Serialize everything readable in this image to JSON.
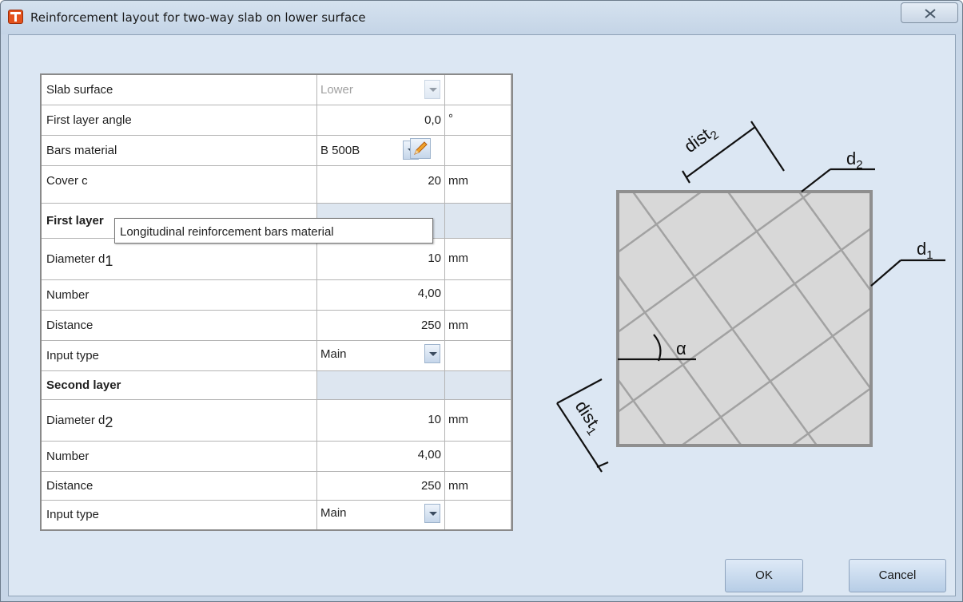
{
  "window": {
    "title": "Reinforcement layout for two-way slab on lower surface",
    "close_icon": "close-x-icon",
    "app_icon": "t-app-icon"
  },
  "grid": {
    "slab_surface": {
      "label": "Slab surface",
      "value": "Lower"
    },
    "first_layer_angle": {
      "label": "First layer angle",
      "value": "0,0",
      "unit": "°"
    },
    "bars_material": {
      "label": "Bars material",
      "value": "B 500B"
    },
    "cover": {
      "label": "Cover  c",
      "value": "20",
      "unit": "mm"
    },
    "first_layer": {
      "header": "First layer",
      "diameter": {
        "label": "Diameter  d",
        "sub": "1",
        "value": "10",
        "unit": "mm"
      },
      "number": {
        "label": "Number",
        "value": "4,00"
      },
      "distance": {
        "label": "Distance",
        "value": "250",
        "unit": "mm"
      },
      "input_type": {
        "label": "Input type",
        "value": "Main"
      }
    },
    "second_layer": {
      "header": "Second layer",
      "diameter": {
        "label": "Diameter  d",
        "sub": "2",
        "value": "10",
        "unit": "mm"
      },
      "number": {
        "label": "Number",
        "value": "4,00"
      },
      "distance": {
        "label": "Distance",
        "value": "250",
        "unit": "mm"
      },
      "input_type": {
        "label": "Input type",
        "value": "Main"
      }
    }
  },
  "tooltip": "Longitudinal reinforcement bars material",
  "drawing": {
    "dist2": "dist",
    "dist2_sub": "2",
    "d2": "d",
    "d2_sub": "2",
    "d1": "d",
    "d1_sub": "1",
    "alpha": "α",
    "dist1": "dist",
    "dist1_sub": "1"
  },
  "buttons": {
    "ok": "OK",
    "cancel": "Cancel"
  }
}
